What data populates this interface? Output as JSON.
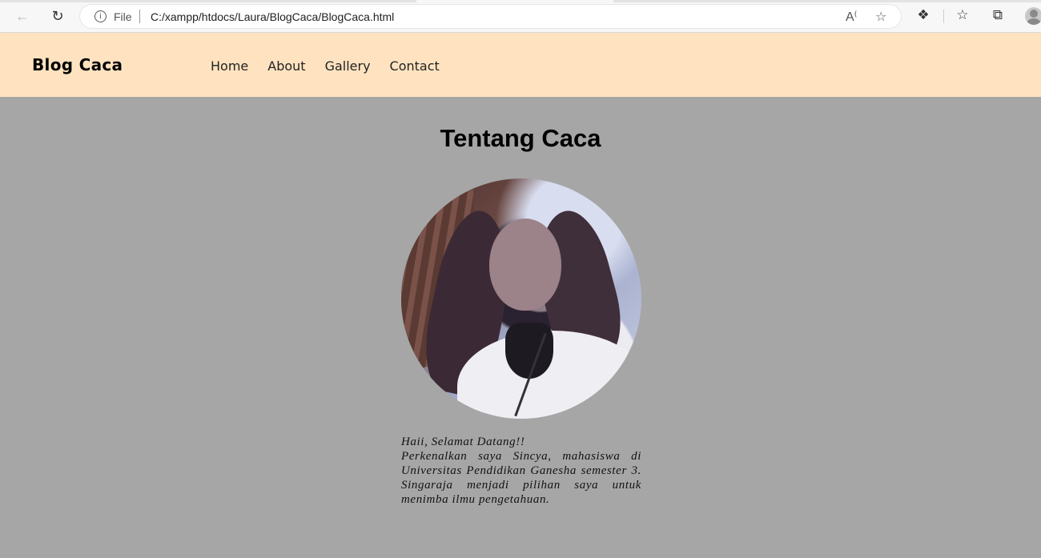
{
  "browser": {
    "file_label": "File",
    "url": "C:/xampp/htdocs/Laura/BlogCaca/BlogCaca.html",
    "icons": [
      "back-icon",
      "reload-icon",
      "info-icon",
      "read-aloud-icon",
      "add-favorite-icon",
      "extensions-icon",
      "favorites-icon",
      "collections-icon",
      "profile-icon"
    ]
  },
  "site": {
    "brand": "Blog Caca",
    "nav": [
      "Home",
      "About",
      "Gallery",
      "Contact"
    ],
    "header_color": "#ffe3c0",
    "background_color": "#a6a6a6"
  },
  "about": {
    "title": "Tentang Caca",
    "greeting": "Haii, Selamat Datang!!",
    "text": "Perkenalkan saya Sincya, mahasiswa di Universitas Pendidikan Ganesha semester 3. Singaraja menjadi pilihan saya untuk menimba ilmu pengetahuan."
  }
}
